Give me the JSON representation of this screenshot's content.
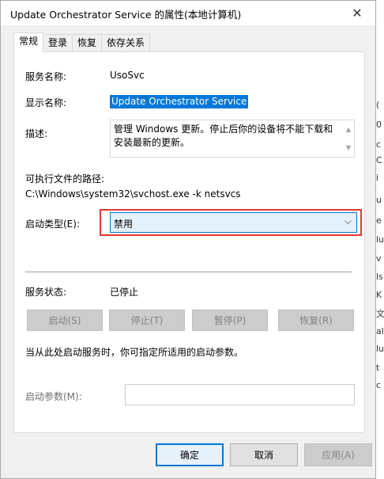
{
  "window": {
    "title": "Update Orchestrator Service 的属性(本地计算机)",
    "close_glyph": "✕"
  },
  "tabs": [
    {
      "label": "常规",
      "active": true
    },
    {
      "label": "登录",
      "active": false
    },
    {
      "label": "恢复",
      "active": false
    },
    {
      "label": "依存关系",
      "active": false
    }
  ],
  "general": {
    "service_name_label": "服务名称:",
    "service_name": "UsoSvc",
    "display_name_label": "显示名称:",
    "display_name": "Update Orchestrator Service",
    "description_label": "描述:",
    "description": "管理 Windows 更新。停止后你的设备将不能下载和安装最新的更新。",
    "path_label": "可执行文件的路径:",
    "path": "C:\\Windows\\system32\\svchost.exe -k netsvcs",
    "startup_type_label": "启动类型(E):",
    "startup_type": "禁用",
    "status_label": "服务状态:",
    "status": "已停止",
    "start_button": "启动(S)",
    "stop_button": "停止(T)",
    "pause_button": "暂停(P)",
    "resume_button": "恢复(R)",
    "hint": "当从此处启动服务时，你可指定所适用的启动参数。",
    "params_label": "启动参数(M):",
    "params_value": ""
  },
  "footer": {
    "ok": "确定",
    "cancel": "取消",
    "apply": "应用(A)"
  },
  "background": {
    "right_chars": [
      "(",
      "0",
      "c",
      "C",
      "i",
      "u",
      "e",
      "lu",
      "v",
      "ls",
      "K",
      "文",
      "al",
      "lu",
      "t",
      "c"
    ],
    "left_chars": [
      "的",
      "e"
    ]
  },
  "colors": {
    "accent": "#0078d7",
    "highlight_box": "#e53935"
  }
}
